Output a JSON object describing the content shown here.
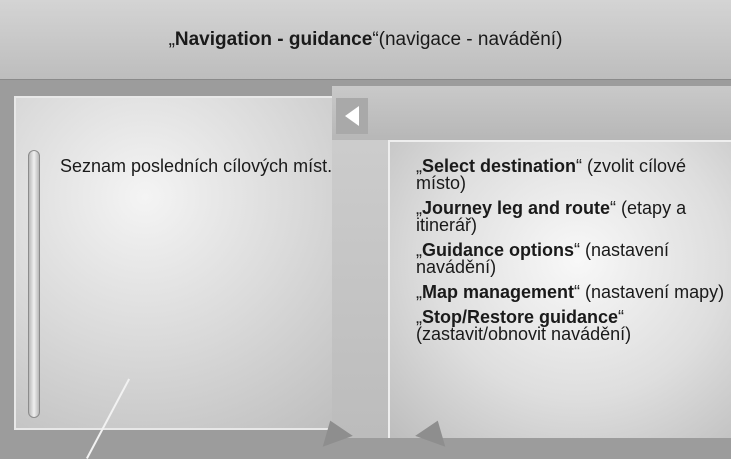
{
  "header": {
    "open_quote": "„",
    "title_bold": "Navigation - guidance",
    "close_quote": "“",
    "title_note": " (navigace - navádění)"
  },
  "left_panel": {
    "label": "Seznam posledních cílových míst."
  },
  "menu": {
    "items": [
      {
        "open_quote": "„",
        "bold": "Select destination",
        "rest": "“ (zvolit cílové místo)"
      },
      {
        "open_quote": "„",
        "bold": "Journey leg and route",
        "rest": "“ (etapy a itinerář)"
      },
      {
        "open_quote": "„",
        "bold": "Guidance options",
        "rest": "“ (nastavení navádění)"
      },
      {
        "open_quote": "„",
        "bold": "Map management",
        "rest": "“ (nastavení mapy)"
      },
      {
        "open_quote": "„",
        "bold": "Stop/Restore guidance",
        "rest": "“ (zastavit/obnovit navádění)"
      }
    ]
  },
  "icons": {
    "back": "back-arrow-icon",
    "scroll": "scrollbar",
    "callout_left": "arrow-left-icon",
    "callout_right": "arrow-right-icon"
  }
}
